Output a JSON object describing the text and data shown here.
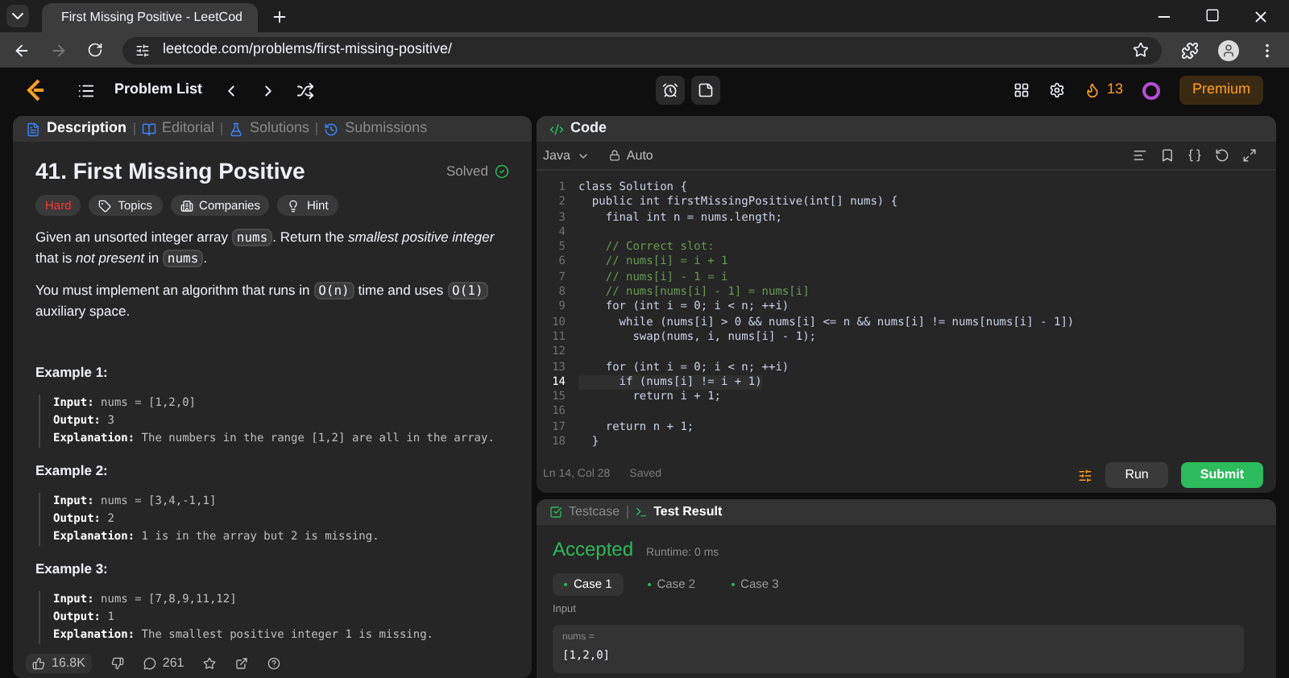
{
  "browser": {
    "tab_title": "First Missing Positive - LeetCod",
    "url": "leetcode.com/problems/first-missing-positive/"
  },
  "nav": {
    "problem_list": "Problem List",
    "streak": "13",
    "premium": "Premium"
  },
  "left_tabs": [
    {
      "label": "Description",
      "selected": true
    },
    {
      "label": "Editorial",
      "selected": false
    },
    {
      "label": "Solutions",
      "selected": false
    },
    {
      "label": "Submissions",
      "selected": false
    }
  ],
  "problem": {
    "title": "41. First Missing Positive",
    "status": "Solved",
    "difficulty": "Hard",
    "chips": [
      "Topics",
      "Companies",
      "Hint"
    ],
    "paragraphs": [
      [
        {
          "kind": "text",
          "text": "Given an unsorted integer array "
        },
        {
          "kind": "code",
          "text": "nums"
        },
        {
          "kind": "text",
          "text": ". Return the "
        },
        {
          "kind": "italic",
          "text": "smallest positive integer"
        },
        {
          "kind": "text",
          "text": " that is "
        },
        {
          "kind": "italic",
          "text": "not present"
        },
        {
          "kind": "text",
          "text": " in "
        },
        {
          "kind": "code",
          "text": "nums"
        },
        {
          "kind": "text",
          "text": "."
        }
      ],
      [
        {
          "kind": "text",
          "text": "You must implement an algorithm that runs in "
        },
        {
          "kind": "code",
          "text": "O(n)"
        },
        {
          "kind": "text",
          "text": " time and uses "
        },
        {
          "kind": "code",
          "text": "O(1)"
        },
        {
          "kind": "text",
          "text": " auxiliary space."
        }
      ]
    ],
    "examples": [
      {
        "title": "Example 1:",
        "lines": [
          {
            "label": "Input:",
            "value": "nums = [1,2,0]"
          },
          {
            "label": "Output:",
            "value": "3"
          },
          {
            "label": "Explanation:",
            "value": "The numbers in the range [1,2] are all in the array."
          }
        ]
      },
      {
        "title": "Example 2:",
        "lines": [
          {
            "label": "Input:",
            "value": "nums = [3,4,-1,1]"
          },
          {
            "label": "Output:",
            "value": "2"
          },
          {
            "label": "Explanation:",
            "value": "1 is in the array but 2 is missing."
          }
        ]
      },
      {
        "title": "Example 3:",
        "lines": [
          {
            "label": "Input:",
            "value": "nums = [7,8,9,11,12]"
          },
          {
            "label": "Output:",
            "value": "1"
          },
          {
            "label": "Explanation:",
            "value": "The smallest positive integer 1 is missing."
          }
        ]
      }
    ],
    "likes": "16.8K",
    "comments": "261"
  },
  "code_panel": {
    "title": "Code",
    "language": "Java",
    "mode": "Auto",
    "lines": [
      {
        "n": "1",
        "kind": "code",
        "text": "class Solution {",
        "selected": false
      },
      {
        "n": "2",
        "kind": "code",
        "text": "  public int firstMissingPositive(int[] nums) {",
        "selected": false
      },
      {
        "n": "3",
        "kind": "code",
        "text": "    final int n = nums.length;",
        "selected": false
      },
      {
        "n": "4",
        "kind": "blank",
        "selected": false
      },
      {
        "n": "5",
        "kind": "comment",
        "text": "    // Correct slot:",
        "selected": false
      },
      {
        "n": "6",
        "kind": "comment",
        "text": "    // nums[i] = i + 1",
        "selected": false
      },
      {
        "n": "7",
        "kind": "comment",
        "text": "    // nums[i] - 1 = i",
        "selected": false
      },
      {
        "n": "8",
        "kind": "comment",
        "text": "    // nums[nums[i] - 1] = nums[i]",
        "selected": false
      },
      {
        "n": "9",
        "kind": "code",
        "text": "    for (int i = 0; i < n; ++i)",
        "selected": false
      },
      {
        "n": "10",
        "kind": "code",
        "text": "      while (nums[i] > 0 && nums[i] <= n && nums[i] != nums[nums[i] - 1])",
        "selected": false
      },
      {
        "n": "11",
        "kind": "code",
        "text": "        swap(nums, i, nums[i] - 1);",
        "selected": false
      },
      {
        "n": "12",
        "kind": "blank",
        "selected": false
      },
      {
        "n": "13",
        "kind": "code",
        "text": "    for (int i = 0; i < n; ++i)",
        "selected": false
      },
      {
        "n": "14",
        "kind": "code",
        "text": "      if (nums[i] != i + 1)",
        "selected": true
      },
      {
        "n": "15",
        "kind": "code",
        "text": "        return i + 1;",
        "selected": false
      },
      {
        "n": "16",
        "kind": "blank",
        "selected": false
      },
      {
        "n": "17",
        "kind": "code",
        "text": "    return n + 1;",
        "selected": false
      },
      {
        "n": "18",
        "kind": "code",
        "text": "  }",
        "selected": false
      }
    ],
    "cursor": "Ln 14, Col 28",
    "saved": "Saved",
    "run": "Run",
    "submit": "Submit"
  },
  "result_tabs": [
    {
      "label": "Testcase",
      "selected": false
    },
    {
      "label": "Test Result",
      "selected": true
    }
  ],
  "result": {
    "verdict": "Accepted",
    "runtime": "Runtime: 0 ms",
    "cases": [
      {
        "label": "Case 1",
        "selected": true
      },
      {
        "label": "Case 2",
        "selected": false
      },
      {
        "label": "Case 3",
        "selected": false
      }
    ],
    "input_label": "Input",
    "var_name": "nums =",
    "var_value": "[1,2,0]"
  }
}
